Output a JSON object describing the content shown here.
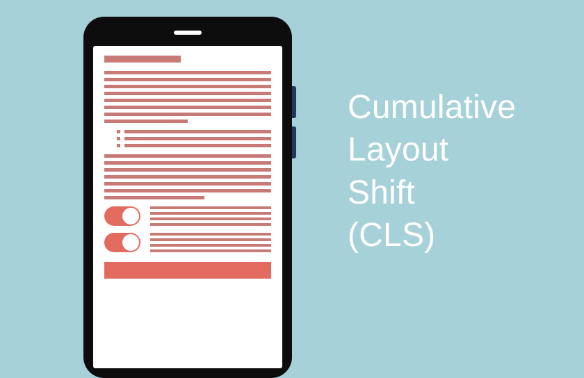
{
  "title": {
    "line1": "Cumulative",
    "line2": "Layout",
    "line3": "Shift",
    "line4": "(CLS)"
  },
  "colors": {
    "background": "#a6d1d8",
    "phone_body": "#0d0d0d",
    "phone_side_button": "#22365f",
    "skeleton_line": "#c77a76",
    "accent": "#e26a5f",
    "text": "#ffffff"
  },
  "phone": {
    "speaker_label": "speaker",
    "side_button_1": "volume-up",
    "side_button_2": "volume-down",
    "toggle_state": "on"
  }
}
